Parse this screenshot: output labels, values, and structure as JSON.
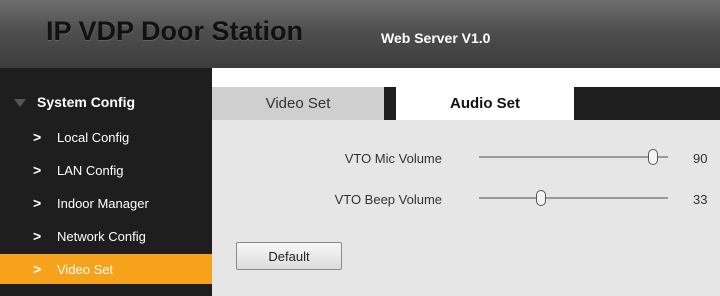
{
  "header": {
    "title": "IP VDP Door Station",
    "subtitle": "Web Server V1.0"
  },
  "sidebar": {
    "section": "System Config",
    "items": [
      {
        "label": "Local Config",
        "active": false
      },
      {
        "label": "LAN Config",
        "active": false
      },
      {
        "label": "Indoor Manager",
        "active": false
      },
      {
        "label": "Network Config",
        "active": false
      },
      {
        "label": "Video Set",
        "active": true
      }
    ]
  },
  "tabs": [
    {
      "label": "Video Set",
      "active": false
    },
    {
      "label": "Audio Set",
      "active": true
    }
  ],
  "audio": {
    "mic_label": "VTO Mic Volume",
    "mic_value": "90",
    "beep_label": "VTO Beep Volume",
    "beep_value": "33",
    "default_button": "Default"
  },
  "colors": {
    "accent": "#f7a21b",
    "sidebar_bg": "#1e1e1e",
    "content_bg": "#e6e6e6"
  }
}
